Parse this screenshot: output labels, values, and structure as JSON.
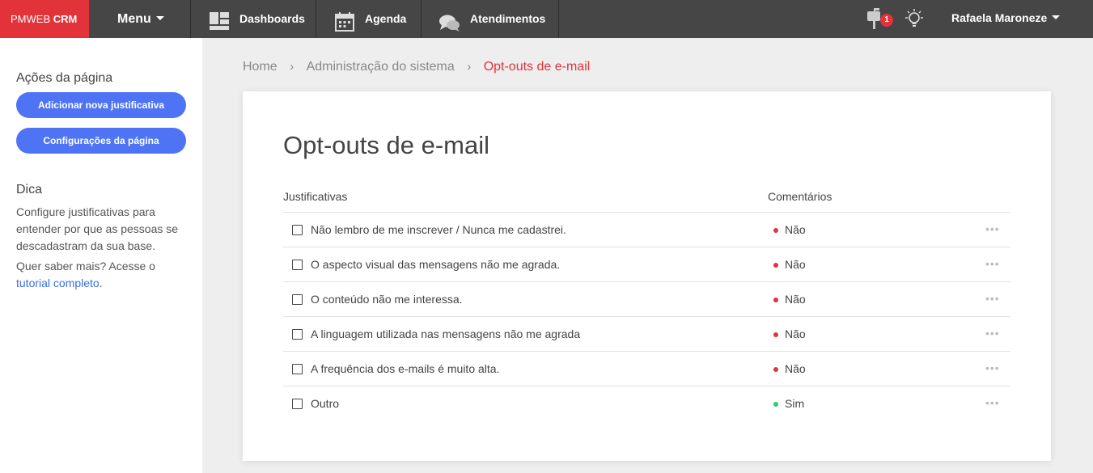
{
  "topbar": {
    "brand_prefix": "PMWEB",
    "brand_suffix": "CRM",
    "menu_label": "Menu",
    "nav": [
      {
        "label": "Dashboards",
        "icon": "dashboard-icon"
      },
      {
        "label": "Agenda",
        "icon": "calendar-icon"
      },
      {
        "label": "Atendimentos",
        "icon": "chat-icon"
      }
    ],
    "notification_count": "1",
    "user_name": "Rafaela Maroneze",
    "brand_color": "#e2333b"
  },
  "sidebar": {
    "actions_title": "Ações da página",
    "buttons": [
      "Adicionar nova justificativa",
      "Configurações da página"
    ],
    "tip_title": "Dica",
    "tip_text": "Configure justificativas para entender por que as pessoas se descadastram da sua base.",
    "more_text": "Quer saber mais? Acesse o",
    "tutorial_link": "tutorial completo",
    "link_end": ".",
    "button_color": "#4e74f5"
  },
  "breadcrumb": {
    "home": "Home",
    "admin": "Administração do sistema",
    "current": "Opt-outs de e-mail",
    "separator": "›"
  },
  "main": {
    "title": "Opt-outs de e-mail",
    "columns": {
      "justificativas": "Justificativas",
      "comentarios": "Comentários"
    },
    "rows": [
      {
        "label": "Não lembro de me inscrever / Nunca me cadastrei.",
        "comment": "Não",
        "status_color": "#e2333b"
      },
      {
        "label": "O aspecto visual das mensagens não me agrada.",
        "comment": "Não",
        "status_color": "#e2333b"
      },
      {
        "label": "O conteúdo não me interessa.",
        "comment": "Não",
        "status_color": "#e2333b"
      },
      {
        "label": "A linguagem utilizada nas mensagens não me agrada",
        "comment": "Não",
        "status_color": "#e2333b"
      },
      {
        "label": "A frequência dos e-mails é muito alta.",
        "comment": "Não",
        "status_color": "#e2333b"
      },
      {
        "label": "Outro",
        "comment": "Sim",
        "status_color": "#2ecc71"
      }
    ],
    "more_glyph": "•••"
  }
}
